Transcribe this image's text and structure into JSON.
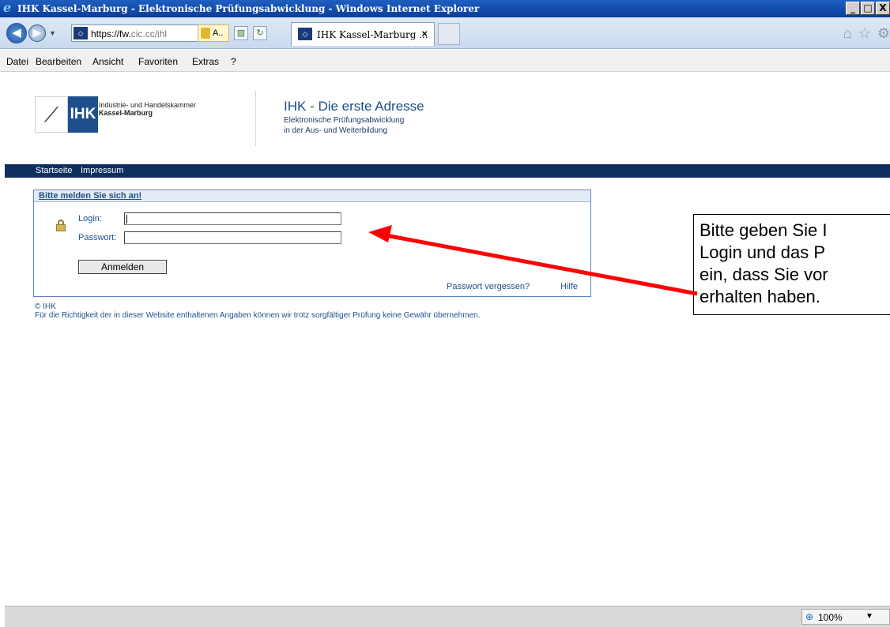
{
  "window": {
    "title": "IHK Kassel-Marburg - Elektronische Prüfungsabwicklung - Windows Internet Explorer",
    "minimize": "_",
    "maximize": "□",
    "close": "X"
  },
  "toolbar": {
    "url_main": "https://fw.",
    "url_rest": "cic.cc/ihl",
    "cert_label": "A..",
    "tab_title": "IHK Kassel-Marburg ...",
    "tab_close": "×"
  },
  "menubar": {
    "items": [
      "Datei",
      "Bearbeiten",
      "Ansicht",
      "Favoriten",
      "Extras",
      "?"
    ]
  },
  "header": {
    "logo_text": "IHK",
    "org_line1": "Industrie- und Handelskammer",
    "org_line2": "Kassel-Marburg",
    "headline": "IHK - Die erste Adresse",
    "sub1": "Elektronische Prüfungsabwicklung",
    "sub2": "in der Aus- und Weiterbildung"
  },
  "nav": {
    "items": [
      "Startseite",
      "Impressum"
    ]
  },
  "login": {
    "heading": "Bitte melden Sie sich an!",
    "login_label": "Login:",
    "password_label": "Passwort:",
    "login_value": "",
    "password_value": "",
    "submit": "Anmelden",
    "forgot": "Passwort vergessen?",
    "help": "Hilfe"
  },
  "footer": {
    "copyright": "© IHK",
    "disclaimer": "Für die Richtigkeit der in dieser Website enthaltenen Angaben können wir trotz sorgfältiger Prüfung keine Gewähr übernehmen."
  },
  "callout": {
    "line1": "Bitte geben Sie I",
    "line2": "Login und das P",
    "line3": "ein, dass Sie vor",
    "line4": "erhalten haben."
  },
  "status": {
    "zoom": "100%"
  },
  "colors": {
    "brand_blue": "#1e4f8c",
    "nav_strip": "#0e2f5e",
    "arrow": "#ff0000"
  }
}
